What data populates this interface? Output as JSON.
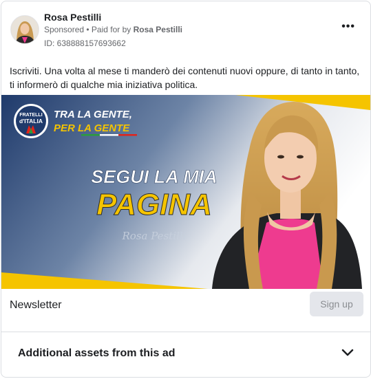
{
  "advertiser": {
    "name": "Rosa Pestilli",
    "sponsored": "Sponsored",
    "paid_for_prefix": " • Paid for by ",
    "paid_for_name": "Rosa Pestilli",
    "ad_id": "ID: 638888157693662"
  },
  "post": {
    "text": "Iscriviti. Una volta al mese ti manderò dei contenuti nuovi oppure, di tanto in tanto, ti informerò di qualche mia iniziativa politica."
  },
  "creative": {
    "logo_line1": "FRATELLI",
    "logo_line2": "d'ITALIA",
    "slogan_line1": "TRA LA GENTE,",
    "slogan_line2": "PER LA GENTE",
    "headline_line1": "SEGUI LA MIA",
    "headline_line2": "PAGINA",
    "signature": "Rosa Pestilli"
  },
  "cta": {
    "label": "Newsletter",
    "button": "Sign up"
  },
  "assets": {
    "label": "Additional assets from this ad"
  },
  "colors": {
    "yellow": "#f5c400",
    "navy": "#1f3a6b",
    "pink": "#ee3b8f"
  },
  "icons": [
    "more-options-icon",
    "chevron-down-icon"
  ]
}
